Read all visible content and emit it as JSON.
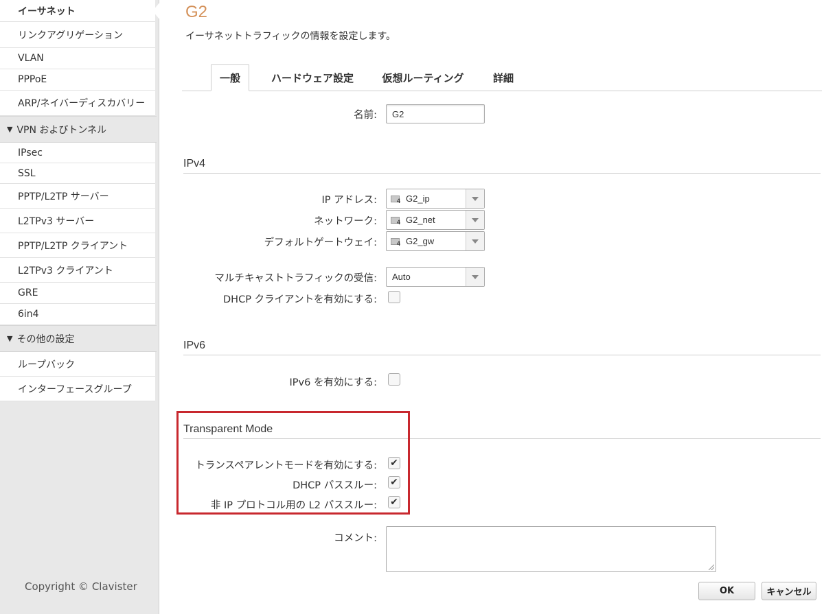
{
  "sidebar": {
    "items_top": [
      {
        "label": "イーサネット",
        "active": true
      },
      {
        "label": "リンクアグリゲーション"
      },
      {
        "label": "VLAN"
      },
      {
        "label": "PPPoE"
      },
      {
        "label": "ARP/ネイバーディスカバリー"
      }
    ],
    "group_vpn": {
      "label": "VPN およびトンネル"
    },
    "items_vpn": [
      {
        "label": "IPsec"
      },
      {
        "label": "SSL"
      },
      {
        "label": "PPTP/L2TP サーバー"
      },
      {
        "label": "L2TPv3 サーバー"
      },
      {
        "label": "PPTP/L2TP クライアント"
      },
      {
        "label": "L2TPv3 クライアント"
      },
      {
        "label": "GRE"
      },
      {
        "label": "6in4"
      }
    ],
    "group_other": {
      "label": "その他の設定"
    },
    "items_other": [
      {
        "label": "ループバック"
      },
      {
        "label": "インターフェースグループ"
      }
    ],
    "copyright": "Copyright © Clavister"
  },
  "page": {
    "title": "G2",
    "description": "イーサネットトラフィックの情報を設定します。"
  },
  "tabs": [
    {
      "label": "一般",
      "active": true
    },
    {
      "label": "ハードウェア設定"
    },
    {
      "label": "仮想ルーティング"
    },
    {
      "label": "詳細"
    }
  ],
  "form": {
    "name": {
      "label": "名前:",
      "value": "G2"
    },
    "ipv4": {
      "section_title": "IPv4",
      "ip_address": {
        "label": "IP アドレス:",
        "value": "G2_ip",
        "icon": "ipv4-address-object-icon"
      },
      "network": {
        "label": "ネットワーク:",
        "value": "G2_net",
        "icon": "ipv4-address-object-icon"
      },
      "default_gateway": {
        "label": "デフォルトゲートウェイ:",
        "value": "G2_gw",
        "icon": "ipv4-address-object-icon"
      },
      "multicast": {
        "label": "マルチキャストトラフィックの受信:",
        "value": "Auto"
      },
      "dhcp_client": {
        "label": "DHCP クライアントを有効にする:",
        "checked": false
      },
      "icon_badge": "4"
    },
    "ipv6": {
      "section_title": "IPv6",
      "enable": {
        "label": "IPv6 を有効にする:",
        "checked": false
      }
    },
    "transparent": {
      "section_title": "Transparent Mode",
      "enable": {
        "label": "トランスペアレントモードを有効にする:",
        "checked": true
      },
      "dhcp_passthrough": {
        "label": "DHCP パススルー:",
        "checked": true
      },
      "l2_passthrough": {
        "label": "非 IP プロトコル用の L2 パススルー:",
        "checked": true
      }
    },
    "comment": {
      "label": "コメント:",
      "value": ""
    }
  },
  "buttons": {
    "ok": "OK",
    "cancel": "キャンセル"
  },
  "colors": {
    "title": "#d4915a",
    "highlight": "#c8282e"
  }
}
